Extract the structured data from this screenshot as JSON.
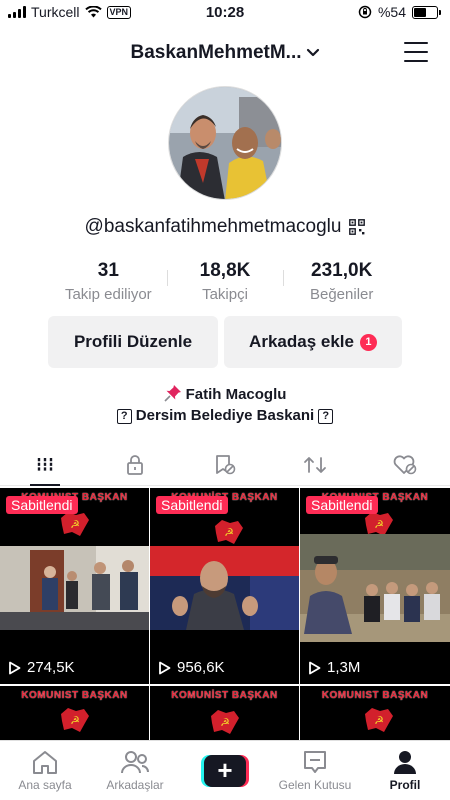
{
  "status_bar": {
    "carrier": "Turkcell",
    "vpn": "VPN",
    "time": "10:28",
    "battery": "%54",
    "battery_level": 0.54
  },
  "header": {
    "title": "BaskanMehmetM..."
  },
  "profile": {
    "username": "@baskanfatihmehmetmacoglu",
    "stats": [
      {
        "value": "31",
        "label": "Takip ediliyor"
      },
      {
        "value": "18,8K",
        "label": "Takipçi"
      },
      {
        "value": "231,0K",
        "label": "Beğeniler"
      }
    ],
    "edit_button": "Profili Düzenle",
    "add_friend_button": "Arkadaş ekle",
    "add_friend_badge": "1",
    "bio_line1": "Fatih Macoglu",
    "bio_line2": "Dersim Belediye Baskani",
    "bio_box_glyph": "?"
  },
  "videos": [
    {
      "pinned": "Sabitlendi",
      "caption": "KOMUNIST BAŞKAN",
      "views": "274,5K"
    },
    {
      "pinned": "Sabitlendi",
      "caption": "KOMUNİST BAŞKAN",
      "views": "956,6K"
    },
    {
      "pinned": "Sabitlendi",
      "caption": "KOMUNIST BAŞKAN",
      "views": "1,3M"
    },
    {
      "caption": "KOMUNIST BAŞKAN"
    },
    {
      "caption": "KOMUNİST BAŞKAN"
    },
    {
      "caption": "KOMUNIST BAŞKAN"
    }
  ],
  "nav": {
    "home": "Ana sayfa",
    "friends": "Arkadaşlar",
    "inbox": "Gelen Kutusu",
    "profile": "Profil"
  },
  "colors": {
    "accent": "#fe2c55",
    "teal": "#25f4ee",
    "text": "#161823",
    "muted": "#8a8b91"
  },
  "icons": [
    "wifi-icon",
    "chevron-down-icon",
    "menu-icon",
    "qr-code-icon",
    "pin-icon",
    "grid-icon",
    "lock-icon",
    "bookmark-icon",
    "repost-icon",
    "liked-icon",
    "play-icon",
    "home-icon",
    "friends-icon",
    "plus-icon",
    "inbox-icon",
    "profile-icon"
  ]
}
